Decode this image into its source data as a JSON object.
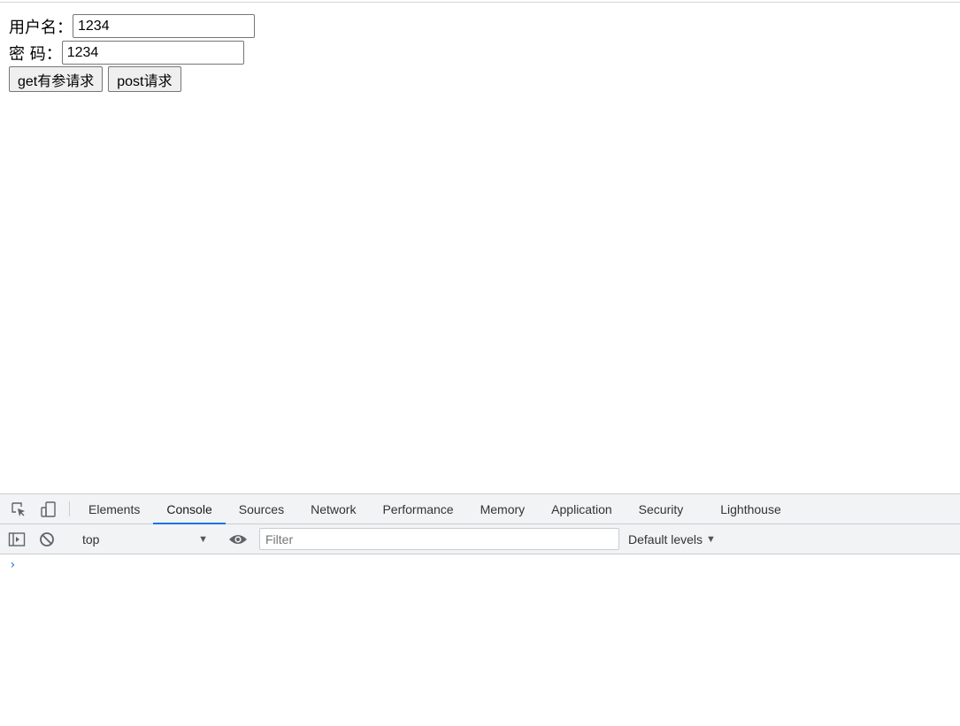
{
  "form": {
    "username_label": "用户名：",
    "username_value": "1234",
    "password_label": "密 码：",
    "password_value": "1234",
    "get_button": "get有参请求",
    "post_button": "post请求"
  },
  "devtools": {
    "tabs": [
      "Elements",
      "Console",
      "Sources",
      "Network",
      "Performance",
      "Memory",
      "Application",
      "Security",
      "Lighthouse"
    ],
    "active_tab": "Console",
    "context": "top",
    "filter_placeholder": "Filter",
    "levels": "Default levels",
    "prompt": "›",
    "icons": {
      "inspect": "inspect-element-icon",
      "device": "device-toolbar-icon",
      "sidebar": "show-sidebar-icon",
      "clear": "clear-console-icon",
      "eye": "live-expression-icon"
    },
    "accent": "#1a73e8"
  }
}
